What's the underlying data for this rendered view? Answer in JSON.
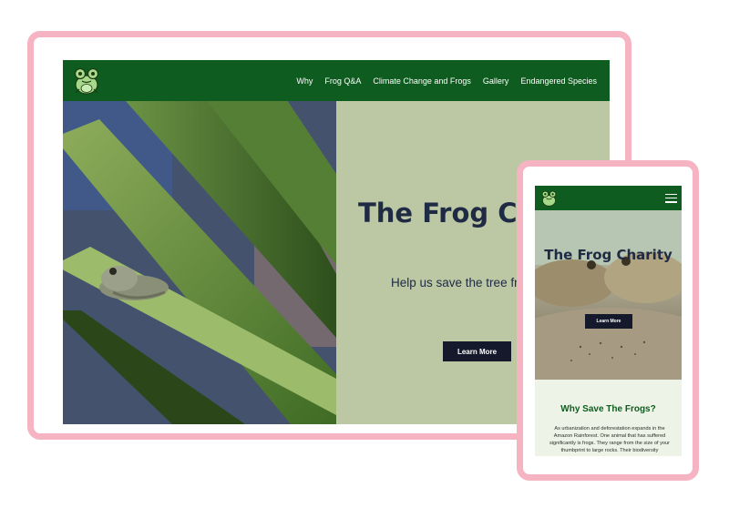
{
  "desktop": {
    "nav": {
      "items": [
        {
          "label": "Why"
        },
        {
          "label": "Frog Q&A"
        },
        {
          "label": "Climate Change and Frogs"
        },
        {
          "label": "Gallery"
        },
        {
          "label": "Endangered Species"
        }
      ]
    },
    "hero": {
      "title": "The Frog Charity",
      "subtitle": "Help us save the tree frogs",
      "button_label": "Learn More"
    }
  },
  "mobile": {
    "hero": {
      "title": "The Frog Charity",
      "button_label": "Learn More"
    },
    "section": {
      "title": "Why Save The Frogs?",
      "body": "As urbanization and deforestation expands in the Amazon Rainforest. One animal that has suffered significantly is frogs. They range from the size of your thumbprint to large rocks. Their biodiversity"
    }
  },
  "colors": {
    "brand_green": "#0e5c1f",
    "hero_sage": "#bcc7a3",
    "navy_text": "#1f2a44",
    "button_dark": "#141a2c",
    "frame_pink": "#f6b3c2"
  },
  "icons": {
    "logo": "frog-logo-icon",
    "menu": "hamburger-menu-icon"
  }
}
